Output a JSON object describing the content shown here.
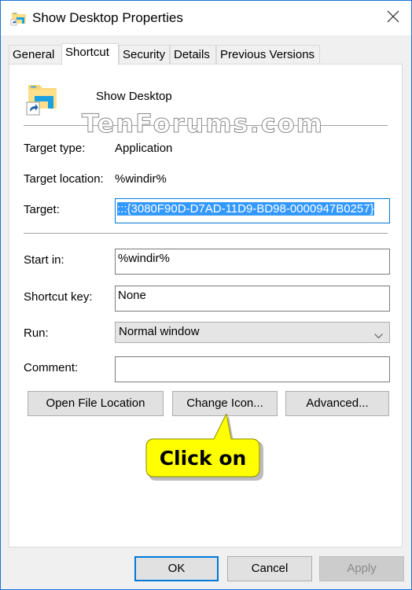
{
  "window": {
    "title": "Show Desktop Properties",
    "close_icon": "close-icon",
    "accent_color": "#0078d7"
  },
  "tabs": [
    {
      "label": "General",
      "active": false
    },
    {
      "label": "Shortcut",
      "active": true
    },
    {
      "label": "Security",
      "active": false
    },
    {
      "label": "Details",
      "active": false
    },
    {
      "label": "Previous Versions",
      "active": false
    }
  ],
  "shortcut": {
    "app_icon": "folder-shortcut-icon",
    "app_name": "Show Desktop",
    "watermark": "TenForums.com",
    "target_type": {
      "label": "Target type:",
      "value": "Application"
    },
    "target_location": {
      "label": "Target location:",
      "value": "%windir%"
    },
    "target": {
      "label": "Target:",
      "value_prefix": ":::",
      "value_selected": "{3080F90D-D7AD-11D9-BD98-0000947B0257}"
    },
    "start_in": {
      "label": "Start in:",
      "value": "%windir%"
    },
    "shortcut_key": {
      "label": "Shortcut key:",
      "value": "None"
    },
    "run": {
      "label": "Run:",
      "value": "Normal window"
    },
    "comment": {
      "label": "Comment:",
      "value": ""
    },
    "buttons": {
      "open_file_location": "Open File Location",
      "change_icon": "Change Icon...",
      "advanced": "Advanced..."
    }
  },
  "annotation": {
    "text": "Click on",
    "color": "#ffff00"
  },
  "footer": {
    "ok": "OK",
    "cancel": "Cancel",
    "apply": "Apply"
  }
}
